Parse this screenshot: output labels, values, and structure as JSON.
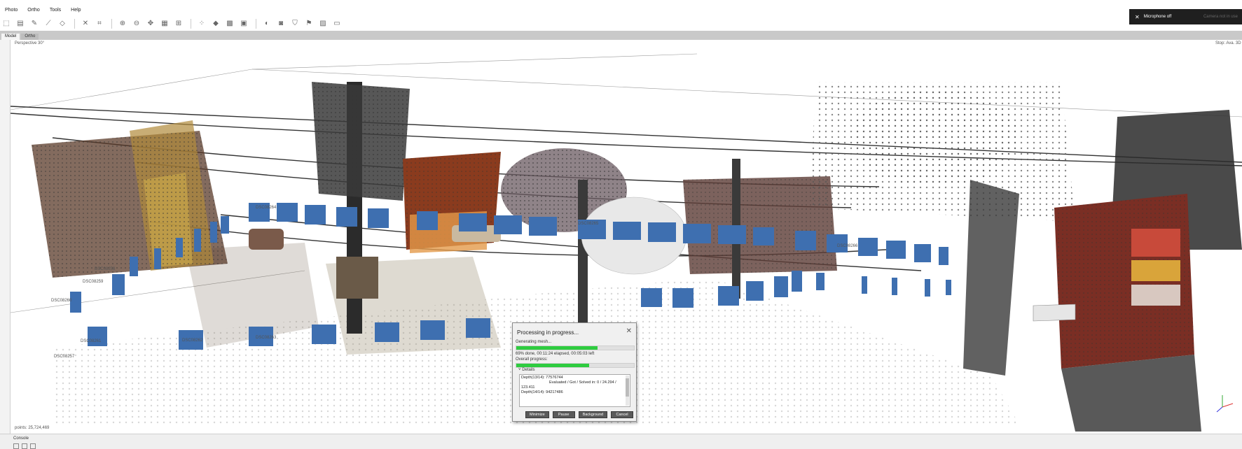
{
  "menu": {
    "items": [
      "Photo",
      "Ortho",
      "Tools",
      "Help"
    ]
  },
  "tabs": [
    {
      "label": "Model",
      "active": true
    },
    {
      "label": "Ortho",
      "active": false
    }
  ],
  "viewport": {
    "projection_label": "Perspective 30°",
    "stereo_label": "Stop: Ava. 3D",
    "points_label": "points: 25,724,469"
  },
  "camera_labels": [
    "DSC08257",
    "DSC08258",
    "DSC08259",
    "DSC08260",
    "DSC08261",
    "DSC08262",
    "DSC08263",
    "DSC08264",
    "DSC08265",
    "DSC08266"
  ],
  "system": {
    "mic_label": "Microphone off",
    "cam_label": "Camera not in use"
  },
  "console": {
    "label": "Console"
  },
  "dialog": {
    "title": "Processing in progress...",
    "task_label": "Generating mesh...",
    "task_progress": 0.69,
    "task_status": "69% done, 00:11:24 elapsed, 00:05:03 left",
    "overall_label": "Overall progress:",
    "overall_progress": 0.62,
    "details_label": "Details",
    "details_lines": [
      "Depth(13/14): 77576744",
      "Evaluated / Got / Solved in: 0 / 24.294 /",
      "123.411",
      "Depth(14/14): 94217486"
    ],
    "buttons": {
      "minimize": "Minimize",
      "pause": "Pause",
      "background": "Background",
      "cancel": "Cancel"
    }
  }
}
